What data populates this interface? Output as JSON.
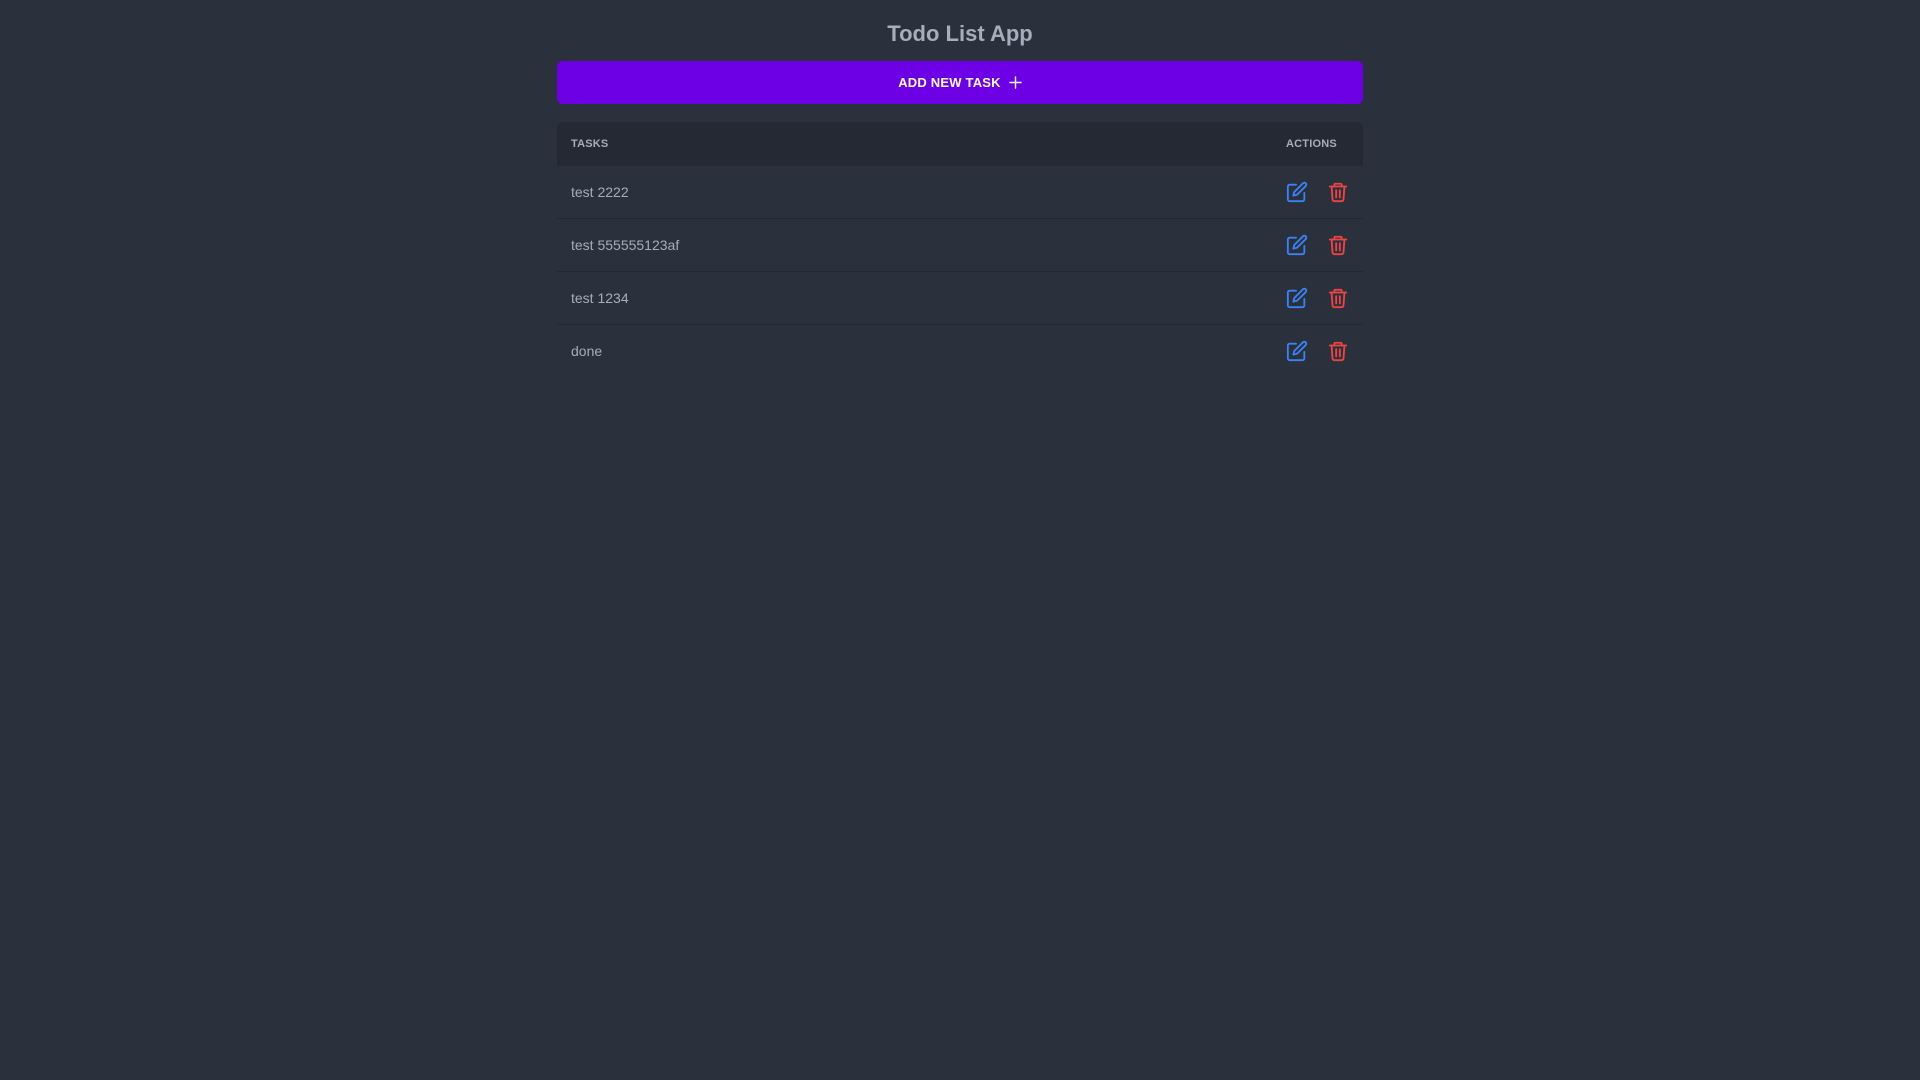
{
  "app": {
    "title": "Todo List App"
  },
  "toolbar": {
    "add_label": "ADD NEW TASK",
    "add_icon": "plus-icon"
  },
  "table": {
    "columns": [
      "TASKS",
      "ACTIONS"
    ],
    "rows": [
      {
        "task": "test 2222"
      },
      {
        "task": "test 555555123af"
      },
      {
        "task": "test 1234"
      },
      {
        "task": "done"
      }
    ],
    "row_action_icons": [
      "edit-icon",
      "trash-icon"
    ]
  },
  "colors": {
    "background": "#2a303c",
    "table_header": "#242933",
    "primary": "#6d00e4",
    "text": "#a6adbb",
    "edit": "#3b82f6",
    "delete": "#ef4444"
  }
}
